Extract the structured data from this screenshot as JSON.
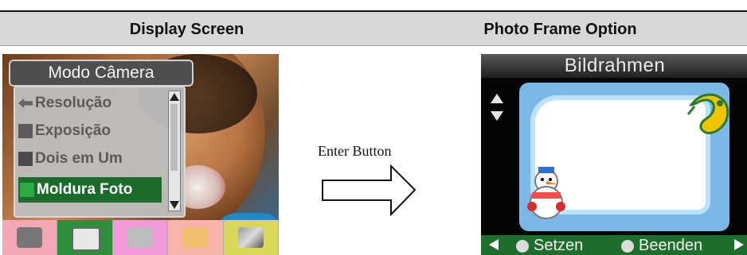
{
  "headers": {
    "left": "Display Screen",
    "right": "Photo Frame Option"
  },
  "left_screen": {
    "menu_title": "Modo Câmera",
    "items": [
      {
        "label": "Resolução",
        "icon": "resolution-icon"
      },
      {
        "label": "Exposição",
        "icon": "exposure-icon"
      },
      {
        "label": "Dois em Um",
        "icon": "two-in-one-icon"
      },
      {
        "label": "Moldura Foto",
        "icon": "photo-frame-icon"
      }
    ],
    "selected_item": "Moldura Foto",
    "tabs": [
      {
        "icon": "video-camera-icon"
      },
      {
        "icon": "camera-icon"
      },
      {
        "icon": "microphone-icon"
      },
      {
        "icon": "palette-icon"
      },
      {
        "icon": "tools-icon"
      }
    ]
  },
  "center": {
    "label": "Enter Button"
  },
  "right_screen": {
    "title": "Bildrahmen",
    "buttons": {
      "set": "Setzen",
      "exit": "Beenden"
    }
  },
  "colors": {
    "header_bg": "#d8d8d8",
    "menu_selected": "#1b6b2a",
    "bottom_bar": "#1d6f2b"
  }
}
